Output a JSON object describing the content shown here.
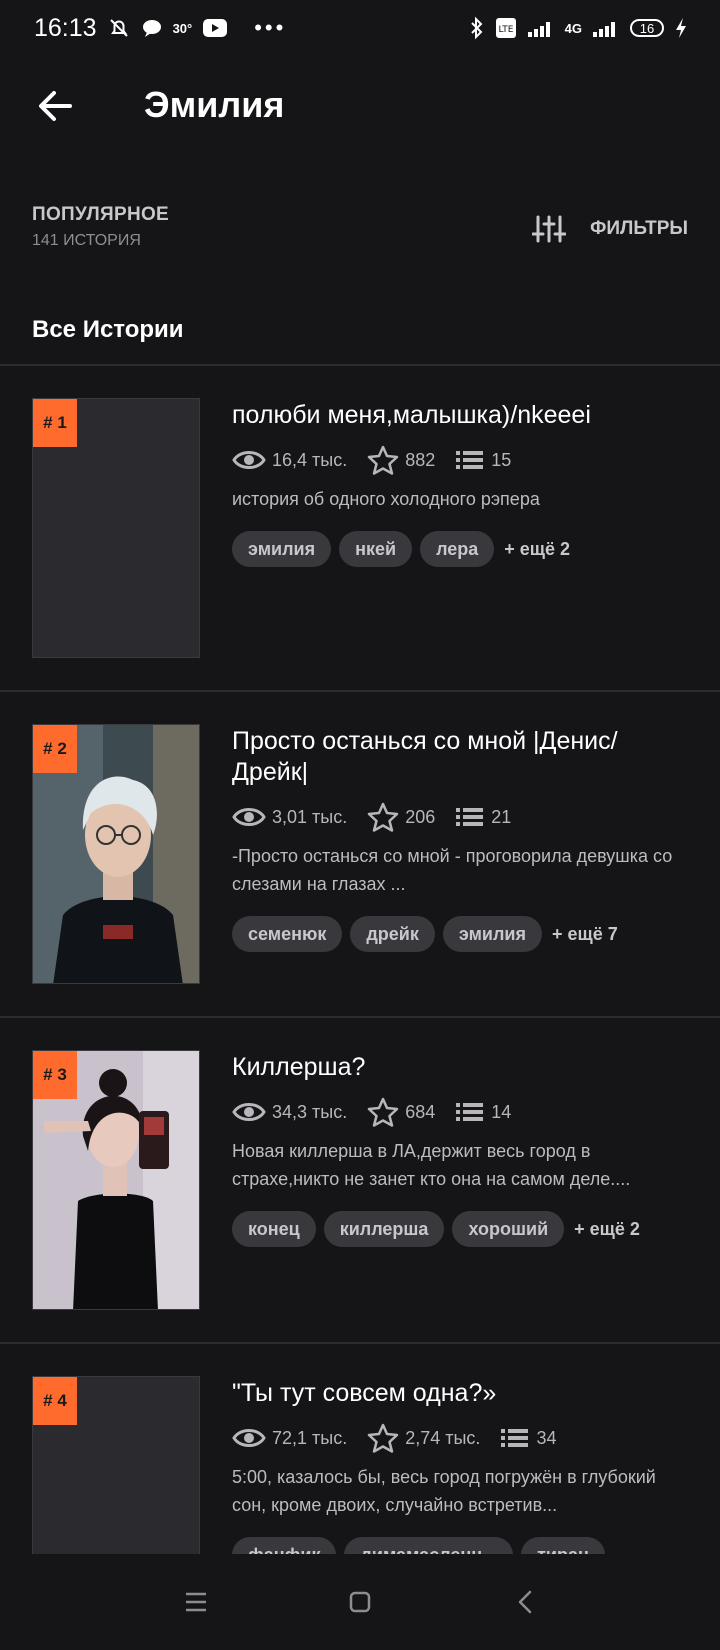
{
  "status_bar": {
    "time": "16:13",
    "temp": "30°",
    "network": "4G",
    "battery": "16"
  },
  "header": {
    "title": "Эмилия"
  },
  "sort": {
    "title": "ПОПУЛЯРНОЕ",
    "count": "141 ИСТОРИЯ",
    "filter_label": "ФИЛЬТРЫ"
  },
  "section_title": "Все Истории",
  "stories": [
    {
      "rank": "# 1",
      "title": "полюби меня,малышка)/nkeeei",
      "views": "16,4 тыс.",
      "votes": "882",
      "parts": "15",
      "description": "история об одного холодного рэпера",
      "tags": [
        "эмилия",
        "нкей",
        "лера"
      ],
      "more": "+ ещё 2",
      "cover": "empty"
    },
    {
      "rank": "# 2",
      "title": "Просто останься со мной |Денис/Дрейк|",
      "views": "3,01 тыс.",
      "votes": "206",
      "parts": "21",
      "description": "-Просто останься со мной - проговорила девушка со слезами на глазах ...",
      "tags": [
        "семенюк",
        "дрейк",
        "эмилия"
      ],
      "more": "+ ещё 7",
      "cover": "boy"
    },
    {
      "rank": "# 3",
      "title": "Киллерша?",
      "views": "34,3 тыс.",
      "votes": "684",
      "parts": "14",
      "description": "Новая киллерша в ЛА,держит весь город в страхе,никто не занет кто она на самом деле....",
      "tags": [
        "конец",
        "киллерша",
        "хороший"
      ],
      "more": "+ ещё 2",
      "cover": "girl"
    },
    {
      "rank": "# 4",
      "title": "\"Ты тут совсем одна?»",
      "views": "72,1 тыс.",
      "votes": "2,74 тыс.",
      "parts": "34",
      "description": "5:00, казалось бы, весь город погружён в глубокий сон, кроме двоих, случайно встретив...",
      "tags": [
        "фанфик",
        "димамасленн...",
        "тиран"
      ],
      "more": "",
      "cover": "empty"
    }
  ],
  "colors": {
    "accent": "#ff6b2d",
    "background": "#151417",
    "tag_bg": "#39383c"
  }
}
